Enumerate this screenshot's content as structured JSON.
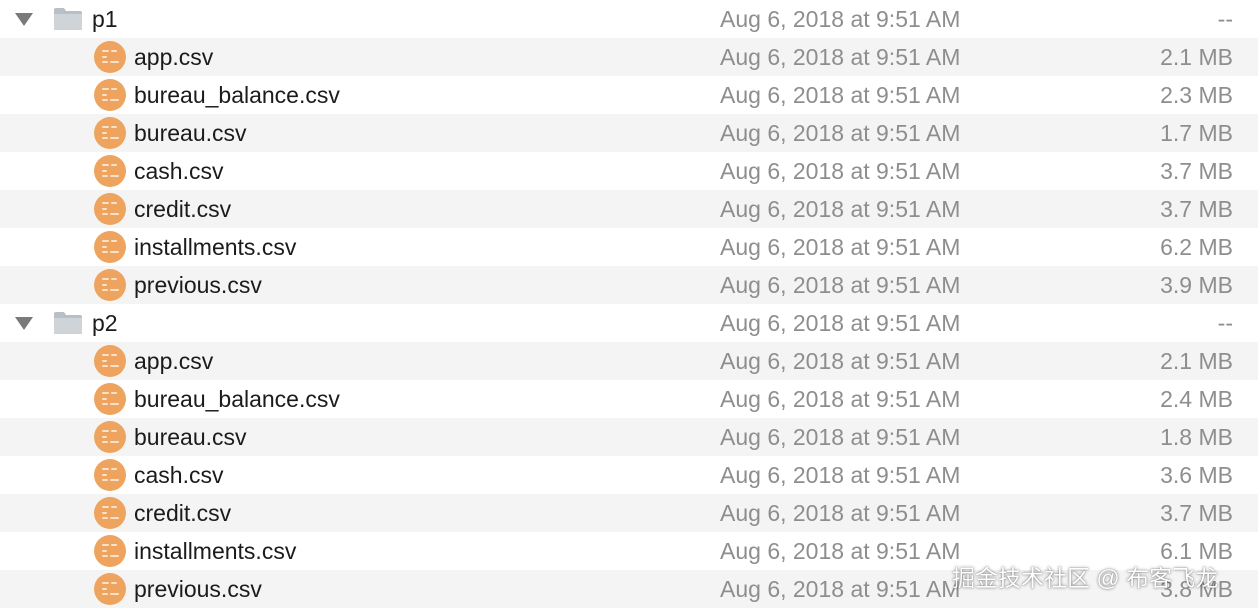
{
  "rows": [
    {
      "type": "folder",
      "name": "p1",
      "date": "Aug 6, 2018 at 9:51 AM",
      "size": "--",
      "expanded": true
    },
    {
      "type": "file",
      "name": "app.csv",
      "date": "Aug 6, 2018 at 9:51 AM",
      "size": "2.1 MB"
    },
    {
      "type": "file",
      "name": "bureau_balance.csv",
      "date": "Aug 6, 2018 at 9:51 AM",
      "size": "2.3 MB"
    },
    {
      "type": "file",
      "name": "bureau.csv",
      "date": "Aug 6, 2018 at 9:51 AM",
      "size": "1.7 MB"
    },
    {
      "type": "file",
      "name": "cash.csv",
      "date": "Aug 6, 2018 at 9:51 AM",
      "size": "3.7 MB"
    },
    {
      "type": "file",
      "name": "credit.csv",
      "date": "Aug 6, 2018 at 9:51 AM",
      "size": "3.7 MB"
    },
    {
      "type": "file",
      "name": "installments.csv",
      "date": "Aug 6, 2018 at 9:51 AM",
      "size": "6.2 MB"
    },
    {
      "type": "file",
      "name": "previous.csv",
      "date": "Aug 6, 2018 at 9:51 AM",
      "size": "3.9 MB"
    },
    {
      "type": "folder",
      "name": "p2",
      "date": "Aug 6, 2018 at 9:51 AM",
      "size": "--",
      "expanded": true
    },
    {
      "type": "file",
      "name": "app.csv",
      "date": "Aug 6, 2018 at 9:51 AM",
      "size": "2.1 MB"
    },
    {
      "type": "file",
      "name": "bureau_balance.csv",
      "date": "Aug 6, 2018 at 9:51 AM",
      "size": "2.4 MB"
    },
    {
      "type": "file",
      "name": "bureau.csv",
      "date": "Aug 6, 2018 at 9:51 AM",
      "size": "1.8 MB"
    },
    {
      "type": "file",
      "name": "cash.csv",
      "date": "Aug 6, 2018 at 9:51 AM",
      "size": "3.6 MB"
    },
    {
      "type": "file",
      "name": "credit.csv",
      "date": "Aug 6, 2018 at 9:51 AM",
      "size": "3.7 MB"
    },
    {
      "type": "file",
      "name": "installments.csv",
      "date": "Aug 6, 2018 at 9:51 AM",
      "size": "6.1 MB"
    },
    {
      "type": "file",
      "name": "previous.csv",
      "date": "Aug 6, 2018 at 9:51 AM",
      "size": "3.8 MB"
    }
  ],
  "watermark": "掘金技术社区 @ 布客飞龙",
  "icons": {
    "folder": "folder-icon",
    "file": "csv-file-icon",
    "disclosure": "disclosure-triangle-down-icon"
  },
  "colors": {
    "row_alt": "#f4f4f4",
    "file_icon": "#eea45e",
    "folder_icon": "#c7ccd1",
    "name_text": "#1b1b1b",
    "meta_text": "#8e8e8e"
  }
}
